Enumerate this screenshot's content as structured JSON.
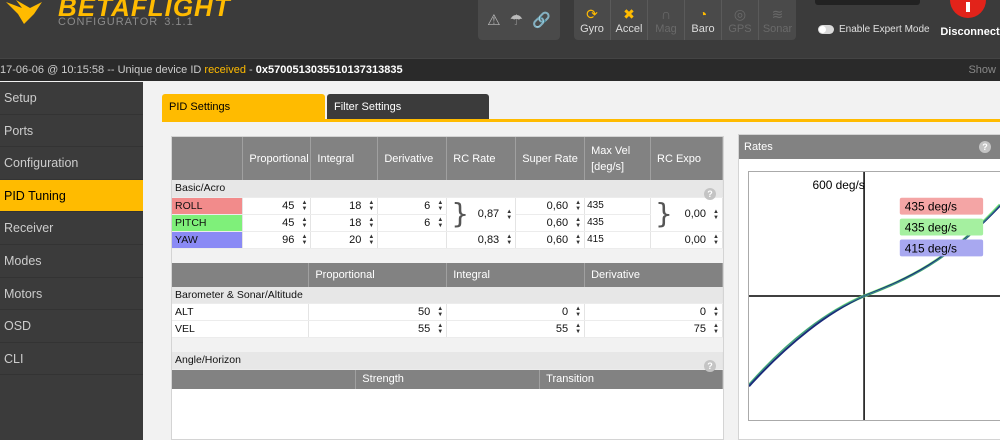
{
  "header": {
    "brand": "BETAFLIGHT",
    "subtitle": "CONFIGURATOR",
    "version": "3.1.1",
    "warning_icons": [
      "warning-icon",
      "parachute-icon",
      "link-icon"
    ],
    "sensors": [
      {
        "label": "Gyro",
        "icon": "gyro-icon",
        "state": "on"
      },
      {
        "label": "Accel",
        "icon": "accel-icon",
        "state": "on"
      },
      {
        "label": "Mag",
        "icon": "mag-icon",
        "state": "off"
      },
      {
        "label": "Baro",
        "icon": "baro-icon",
        "state": "on"
      },
      {
        "label": "GPS",
        "icon": "gps-icon",
        "state": "off"
      },
      {
        "label": "Sonar",
        "icon": "sonar-icon",
        "state": "off"
      }
    ],
    "expert_mode_label": "Enable Expert Mode",
    "disconnect_label": "Disconnect"
  },
  "logbar": {
    "timestamp": "17-06-06 @ 10:15:58",
    "message": " -- Unique device ID ",
    "status": "received",
    "separator": " - ",
    "device_id": "0x5700513035510137313835",
    "show_label": "Show"
  },
  "sidebar": {
    "items": [
      "Setup",
      "Ports",
      "Configuration",
      "PID Tuning",
      "Receiver",
      "Modes",
      "Motors",
      "OSD",
      "CLI"
    ],
    "active": "PID Tuning"
  },
  "tabs": [
    {
      "label": "PID Settings",
      "active": true
    },
    {
      "label": "Filter Settings",
      "active": false
    }
  ],
  "pid_table": {
    "headers": [
      "Proportional",
      "Integral",
      "Derivative",
      "RC Rate",
      "Super Rate",
      "Max Vel [deg/s]",
      "RC Expo"
    ],
    "section_label": "Basic/Acro",
    "rows": [
      {
        "axis": "ROLL",
        "p": "45",
        "i": "18",
        "d": "6",
        "rc_rate": "0,87",
        "super_rate": "0,60",
        "max_vel": "435",
        "rc_expo": "0,00"
      },
      {
        "axis": "PITCH",
        "p": "45",
        "i": "18",
        "d": "6",
        "rc_rate": "",
        "super_rate": "0,60",
        "max_vel": "435",
        "rc_expo": ""
      },
      {
        "axis": "YAW",
        "p": "96",
        "i": "20",
        "d": "",
        "rc_rate": "0,83",
        "super_rate": "0,60",
        "max_vel": "415",
        "rc_expo": "0,00"
      }
    ]
  },
  "baro_table": {
    "headers": [
      "Proportional",
      "Integral",
      "Derivative"
    ],
    "section_label": "Barometer & Sonar/Altitude",
    "rows": [
      {
        "label": "ALT",
        "p": "50",
        "i": "0",
        "d": "0"
      },
      {
        "label": "VEL",
        "p": "55",
        "i": "55",
        "d": "75"
      }
    ]
  },
  "angle_table": {
    "section_label": "Angle/Horizon",
    "headers": [
      "Strength",
      "Transition"
    ]
  },
  "rates": {
    "title": "Rates",
    "max_label": "600 deg/s",
    "legend": [
      {
        "label": "435 deg/s",
        "color": "#f4a5a5"
      },
      {
        "label": "435 deg/s",
        "color": "#a5f0a0"
      },
      {
        "label": "415 deg/s",
        "color": "#a8a8f0"
      }
    ]
  },
  "colors": {
    "accent": "#ffbb00",
    "roll": "#f28b8b",
    "pitch": "#7ff07a",
    "yaw": "#8a8af5"
  }
}
